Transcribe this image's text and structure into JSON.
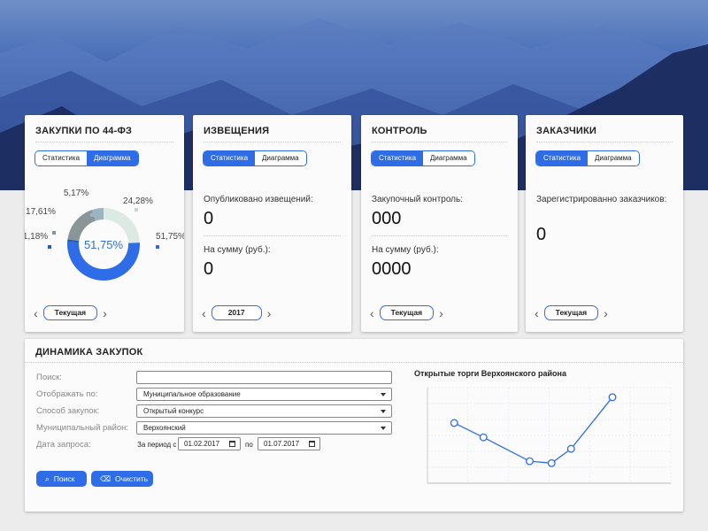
{
  "cards": [
    {
      "title": "ЗАКУПКИ ПО 44-ФЗ",
      "tabs": [
        "Статистика",
        "Диаграмма"
      ],
      "active_tab": 1,
      "pager": "Текущая",
      "chart_data": {
        "type": "pie",
        "center_label": "51,75%",
        "slices": [
          {
            "label": "24,28%",
            "value": 24.28,
            "color": "#dde9e3"
          },
          {
            "label": "51,75%",
            "value": 51.75,
            "color": "#2f6de8"
          },
          {
            "label": "1,18%",
            "value": 1.18,
            "color": "#2a5ab8"
          },
          {
            "label": "17,61%",
            "value": 17.61,
            "color": "#8a9598"
          },
          {
            "label": "5,17%",
            "value": 5.17,
            "color": "#9ab5bf"
          }
        ]
      }
    },
    {
      "title": "ИЗВЕЩЕНИЯ",
      "tabs": [
        "Статистика",
        "Диаграмма"
      ],
      "active_tab": 0,
      "label1": "Опубликовано извещений:",
      "value1": "0",
      "label2": "На сумму (руб.):",
      "value2": "0",
      "pager": "2017"
    },
    {
      "title": "КОНТРОЛЬ",
      "tabs": [
        "Статистика",
        "Диаграмма"
      ],
      "active_tab": 0,
      "label1": "Закупочный контроль:",
      "value1": "000",
      "label2": "На сумму (руб.):",
      "value2": "0000",
      "pager": "Текущая"
    },
    {
      "title": "ЗАКАЗЧИКИ",
      "tabs": [
        "Статистика",
        "Диаграмма"
      ],
      "active_tab": 0,
      "label1": "Зарегистрированно заказчиков:",
      "value1": "0",
      "pager": "Текущая"
    }
  ],
  "dynamics": {
    "title": "ДИНАМИКА ЗАКУПОК",
    "search_label": "Поиск:",
    "search_value": "",
    "display_label": "Отображать по:",
    "display_value": "Муниципальное образование",
    "method_label": "Способ закупок:",
    "method_value": "Открытый конкурс",
    "district_label": "Муниципальный район:",
    "district_value": "Верхоянский",
    "date_label": "Дата запроса:",
    "period_from_label": "За период с",
    "date_from": "01.02.2017",
    "period_to_label": "по",
    "date_to": "01.07.2017",
    "search_button": "Поиск",
    "clear_button": "Очистить"
  },
  "chart_data": {
    "type": "line",
    "title": "Открытые торги Верхоянского района",
    "xlabel": "",
    "ylabel": "",
    "xlim": [
      0,
      100
    ],
    "ylim": [
      0,
      100
    ],
    "grid": true,
    "x": [
      11,
      23,
      42,
      51,
      59,
      76
    ],
    "values": [
      63,
      48,
      23,
      21,
      36,
      90
    ]
  },
  "colors": {
    "accent": "#2f6de8"
  }
}
